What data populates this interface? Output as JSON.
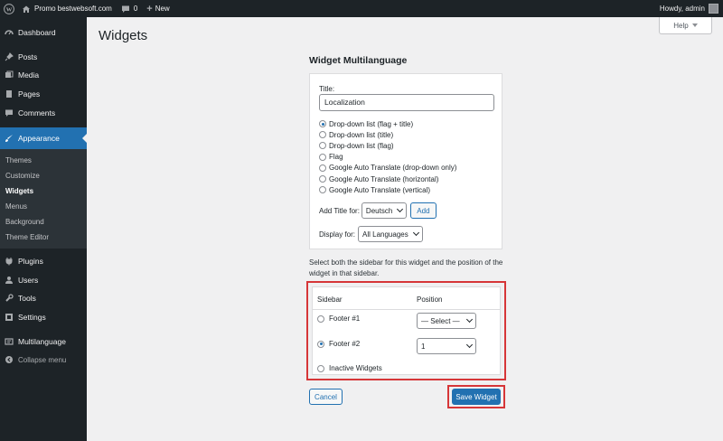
{
  "adminbar": {
    "site_name": "Promo bestwebsoft.com",
    "comments_count": "0",
    "new_label": "New",
    "greeting": "Howdy, admin"
  },
  "sidebar": {
    "items": [
      {
        "label": "Dashboard",
        "icon": "dashboard-icon"
      },
      {
        "label": "Posts",
        "icon": "pin-icon"
      },
      {
        "label": "Media",
        "icon": "media-icon"
      },
      {
        "label": "Pages",
        "icon": "page-icon"
      },
      {
        "label": "Comments",
        "icon": "comment-icon"
      },
      {
        "label": "Appearance",
        "icon": "brush-icon"
      },
      {
        "label": "Plugins",
        "icon": "plugin-icon"
      },
      {
        "label": "Users",
        "icon": "users-icon"
      },
      {
        "label": "Tools",
        "icon": "wrench-icon"
      },
      {
        "label": "Settings",
        "icon": "settings-icon"
      },
      {
        "label": "Multilanguage",
        "icon": "translate-icon"
      },
      {
        "label": "Collapse menu",
        "icon": "collapse-icon"
      }
    ],
    "appearance_sub": [
      "Themes",
      "Customize",
      "Widgets",
      "Menus",
      "Background",
      "Theme Editor"
    ]
  },
  "header": {
    "title": "Widgets",
    "help_label": "Help"
  },
  "widget": {
    "heading": "Widget Multilanguage",
    "title_label": "Title:",
    "title_value": "Localization",
    "display_options": [
      "Drop-down list (flag + title)",
      "Drop-down list (title)",
      "Drop-down list (flag)",
      "Flag",
      "Google Auto Translate (drop-down only)",
      "Google Auto Translate (horizontal)",
      "Google Auto Translate (vertical)"
    ],
    "add_title_label": "Add Title for:",
    "add_title_language": "Deutsch",
    "add_button": "Add",
    "display_for_label": "Display for:",
    "display_for_value": "All Languages"
  },
  "placement": {
    "description": "Select both the sidebar for this widget and the position of the widget in that sidebar.",
    "col_sidebar": "Sidebar",
    "col_position": "Position",
    "rows": [
      {
        "sidebar": "Footer #1",
        "position": "— Select —"
      },
      {
        "sidebar": "Footer #2",
        "position": "1"
      },
      {
        "sidebar": "Inactive Widgets"
      }
    ]
  },
  "actions": {
    "cancel": "Cancel",
    "save": "Save Widget"
  },
  "colors": {
    "accent": "#2271b1",
    "highlight": "#d63638",
    "menu_bg": "#1d2327"
  }
}
